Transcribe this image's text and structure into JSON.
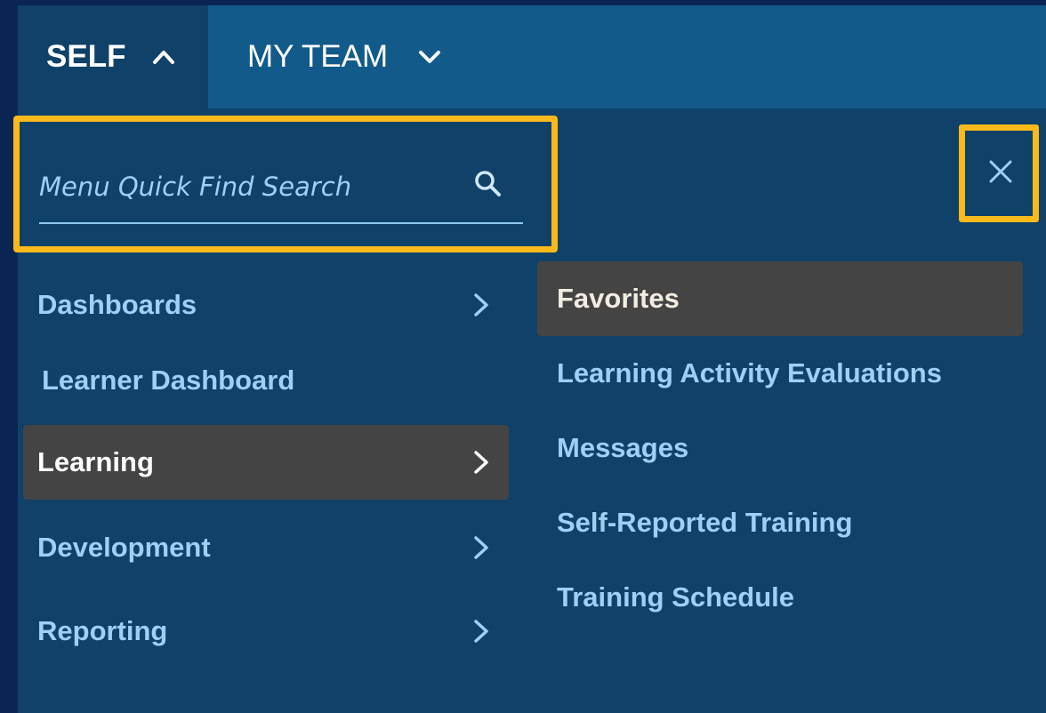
{
  "tabs": {
    "self_label": "SELF",
    "team_label": "MY TEAM"
  },
  "search": {
    "placeholder": "Menu Quick Find Search",
    "value": ""
  },
  "left_menu": {
    "items": [
      {
        "label": "Dashboards"
      },
      {
        "label": "Learner Dashboard"
      },
      {
        "label": "Learning"
      },
      {
        "label": "Development"
      },
      {
        "label": "Reporting"
      }
    ]
  },
  "right_menu": {
    "items": [
      {
        "label": "Favorites"
      },
      {
        "label": "Learning Activity Evaluations"
      },
      {
        "label": "Messages"
      },
      {
        "label": "Self-Reported Training"
      },
      {
        "label": "Training Schedule"
      }
    ]
  },
  "colors": {
    "background": "#0a2552",
    "panel": "#0f4169",
    "tabbar": "#125a8a",
    "link": "#9fd0f4",
    "active_item": "#444444",
    "highlight": "#fbb91b"
  },
  "icons": [
    "chevron-up-icon",
    "chevron-down-icon",
    "search-icon",
    "close-icon",
    "chevron-right-icon"
  ]
}
